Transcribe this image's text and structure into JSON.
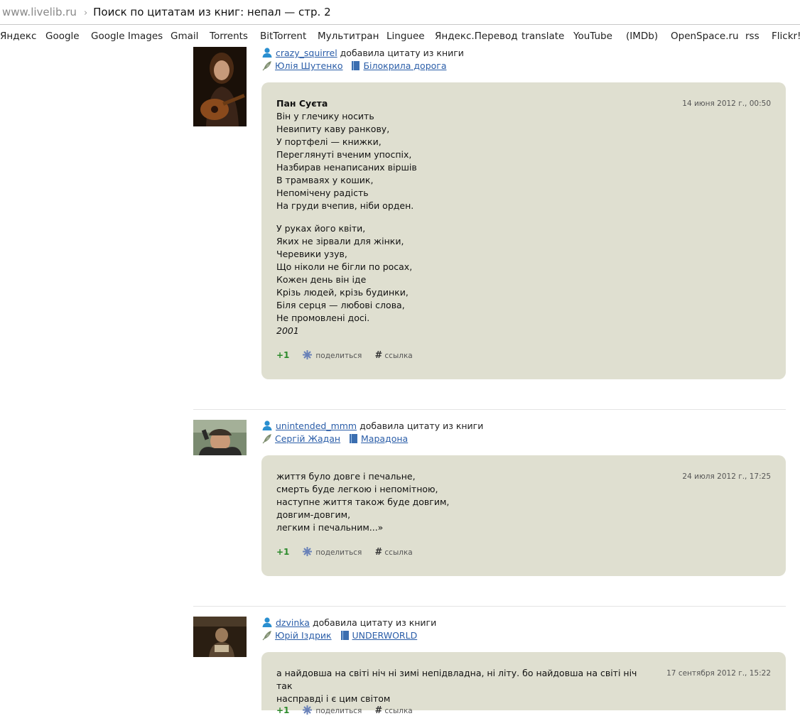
{
  "address": {
    "domain": "www.livelib.ru",
    "separator": "›",
    "title": "Поиск по цитатам из книг: непал — стр. 2"
  },
  "bookmarks": [
    "Яндекс",
    "Google",
    "Google Images",
    "Gmail",
    "Torrents",
    "BitTorrent",
    "Мультитран",
    "Linguee",
    "Яндекс.Перевод",
    "translate",
    "YouTube",
    "(IMDb)",
    "OpenSpace.ru",
    "rss",
    "Flickr!"
  ],
  "action_text": "добавила цитату из книги",
  "plus_label": "+1",
  "share_label": "поделиться",
  "link_label": "ссылка",
  "posts": [
    {
      "user": "crazy_squirrel",
      "author": "Юлія Шутенко",
      "book": "Білокрила дорога",
      "date": "14 июня 2012 г., 00:50",
      "title": "Пан Суєта",
      "lines": [
        "Він у глечику носить",
        "Невипиту каву ранкову,",
        "У портфелі — книжки,",
        "Переглянуті вченим упоспіх,",
        "Назбирав ненаписаних віршів",
        "В трамваях у кошик,",
        "Непомічену радість",
        "На груди вчепив, ніби орден."
      ],
      "lines2": [
        "У руках його квіти,",
        "Яких не зірвали для жінки,",
        "Черевики узув,",
        "Що ніколи не бігли по росах,",
        "Кожен день він іде",
        "Крізь людей, крізь будинки,",
        "Біля серця — любові слова,",
        "Не промовлені досі."
      ],
      "year": "2001"
    },
    {
      "user": "unintended_mmm",
      "author": "Сергій Жадан",
      "book": "Марадона",
      "date": "24 июля 2012 г., 17:25",
      "lines": [
        "життя було довге і печальне,",
        "смерть буде легкою і непомітною,",
        "наступне життя також буде довгим,",
        "довгим-довгим,",
        "легким і печальним...»"
      ]
    },
    {
      "user": "dzvinka",
      "author": "Юрій Іздрик",
      "book": "UNDERWORLD",
      "date": "17 сентября 2012 г., 15:22",
      "lines": [
        "а найдовша на світі ніч ні зимі непідвладна, ні літу. бо найдовша на світі ніч так",
        "насправді і є цим світом"
      ]
    }
  ]
}
